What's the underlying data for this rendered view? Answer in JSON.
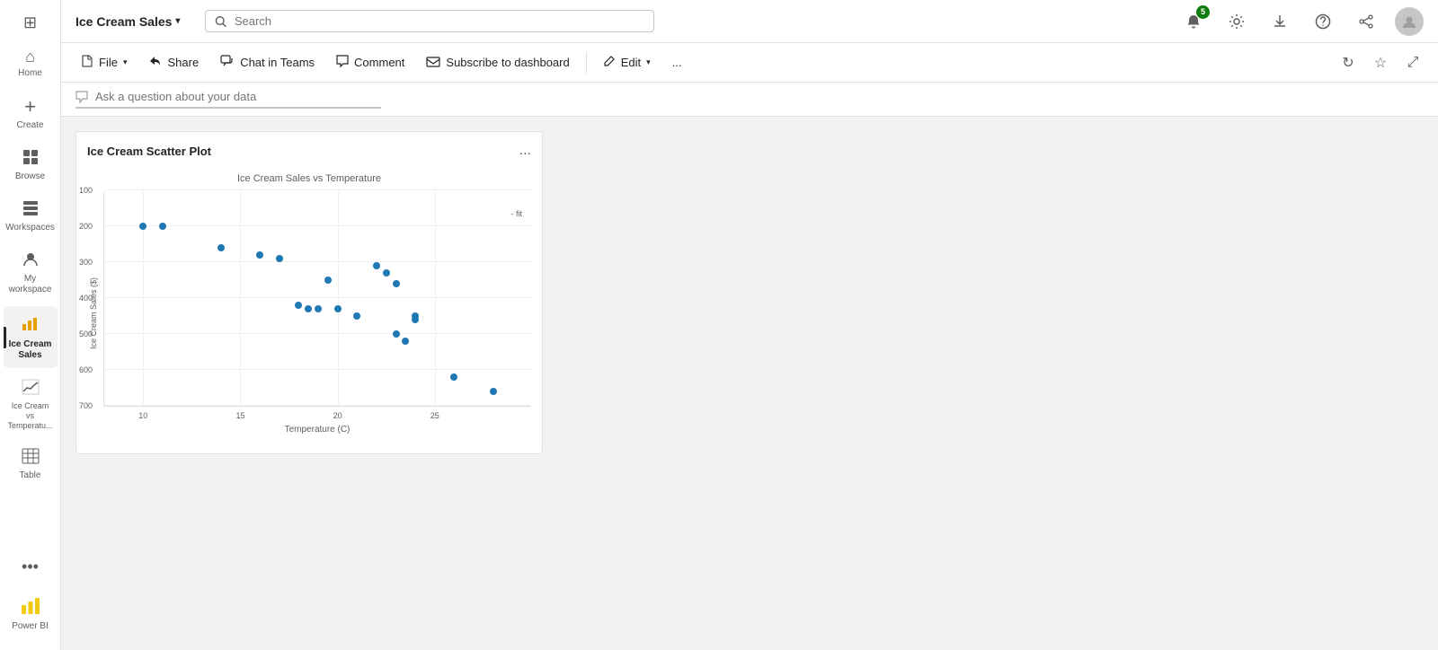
{
  "app": {
    "title": "Ice Cream Sales",
    "powerbi_label": "Power BI"
  },
  "topbar": {
    "title": "Ice Cream Sales",
    "chevron": "▾",
    "search_placeholder": "Search",
    "notification_count": "5",
    "icons": {
      "apps": "⊞",
      "notification": "🔔",
      "settings": "⚙",
      "download": "⬇",
      "help": "?",
      "share_teams": "🔗"
    }
  },
  "toolbar": {
    "file_label": "File",
    "share_label": "Share",
    "chat_teams_label": "Chat in Teams",
    "comment_label": "Comment",
    "subscribe_label": "Subscribe to dashboard",
    "edit_label": "Edit",
    "more": "...",
    "refresh_icon": "↻",
    "favorite_icon": "☆",
    "fullscreen_icon": "⤢"
  },
  "ask_bar": {
    "placeholder": "Ask a question about your data"
  },
  "sidebar": {
    "items": [
      {
        "id": "home",
        "label": "Home",
        "icon": "⌂"
      },
      {
        "id": "create",
        "label": "Create",
        "icon": "+"
      },
      {
        "id": "browse",
        "label": "Browse",
        "icon": "📁"
      },
      {
        "id": "workspaces",
        "label": "Workspaces",
        "icon": "▦"
      },
      {
        "id": "my-workspace",
        "label": "My workspace",
        "icon": "👤"
      },
      {
        "id": "ice-cream-sales",
        "label": "Ice Cream Sales",
        "icon": "📊",
        "active": true
      },
      {
        "id": "ice-cream-temp",
        "label": "Ice Cream vs Temperatu...",
        "icon": "📈"
      },
      {
        "id": "table",
        "label": "Table",
        "icon": "⊞"
      }
    ],
    "more_label": "...",
    "powerbi_label": "Power BI"
  },
  "chart": {
    "title": "Ice Cream Scatter Plot",
    "plot_title": "Ice Cream Sales vs Temperature",
    "y_axis_label": "Ice Cream Sales ($)",
    "x_axis_label": "Temperature (C)",
    "fit_label": "- fit",
    "y_ticks": [
      "100",
      "200",
      "300",
      "400",
      "500",
      "600",
      "700"
    ],
    "x_ticks": [
      "10",
      "15",
      "20",
      "25"
    ],
    "data_points": [
      {
        "temp": 10,
        "sales": 200
      },
      {
        "temp": 11,
        "sales": 200
      },
      {
        "temp": 14,
        "sales": 260
      },
      {
        "temp": 16,
        "sales": 280
      },
      {
        "temp": 17,
        "sales": 290
      },
      {
        "temp": 18,
        "sales": 420
      },
      {
        "temp": 18.5,
        "sales": 430
      },
      {
        "temp": 19,
        "sales": 430
      },
      {
        "temp": 19.5,
        "sales": 350
      },
      {
        "temp": 20,
        "sales": 430
      },
      {
        "temp": 21,
        "sales": 450
      },
      {
        "temp": 22,
        "sales": 310
      },
      {
        "temp": 22.5,
        "sales": 330
      },
      {
        "temp": 23,
        "sales": 360
      },
      {
        "temp": 23,
        "sales": 500
      },
      {
        "temp": 23.5,
        "sales": 520
      },
      {
        "temp": 24,
        "sales": 460
      },
      {
        "temp": 24,
        "sales": 450
      },
      {
        "temp": 26,
        "sales": 620
      },
      {
        "temp": 28,
        "sales": 660
      }
    ],
    "temp_min": 8,
    "temp_max": 30,
    "sales_min": 100,
    "sales_max": 700
  }
}
